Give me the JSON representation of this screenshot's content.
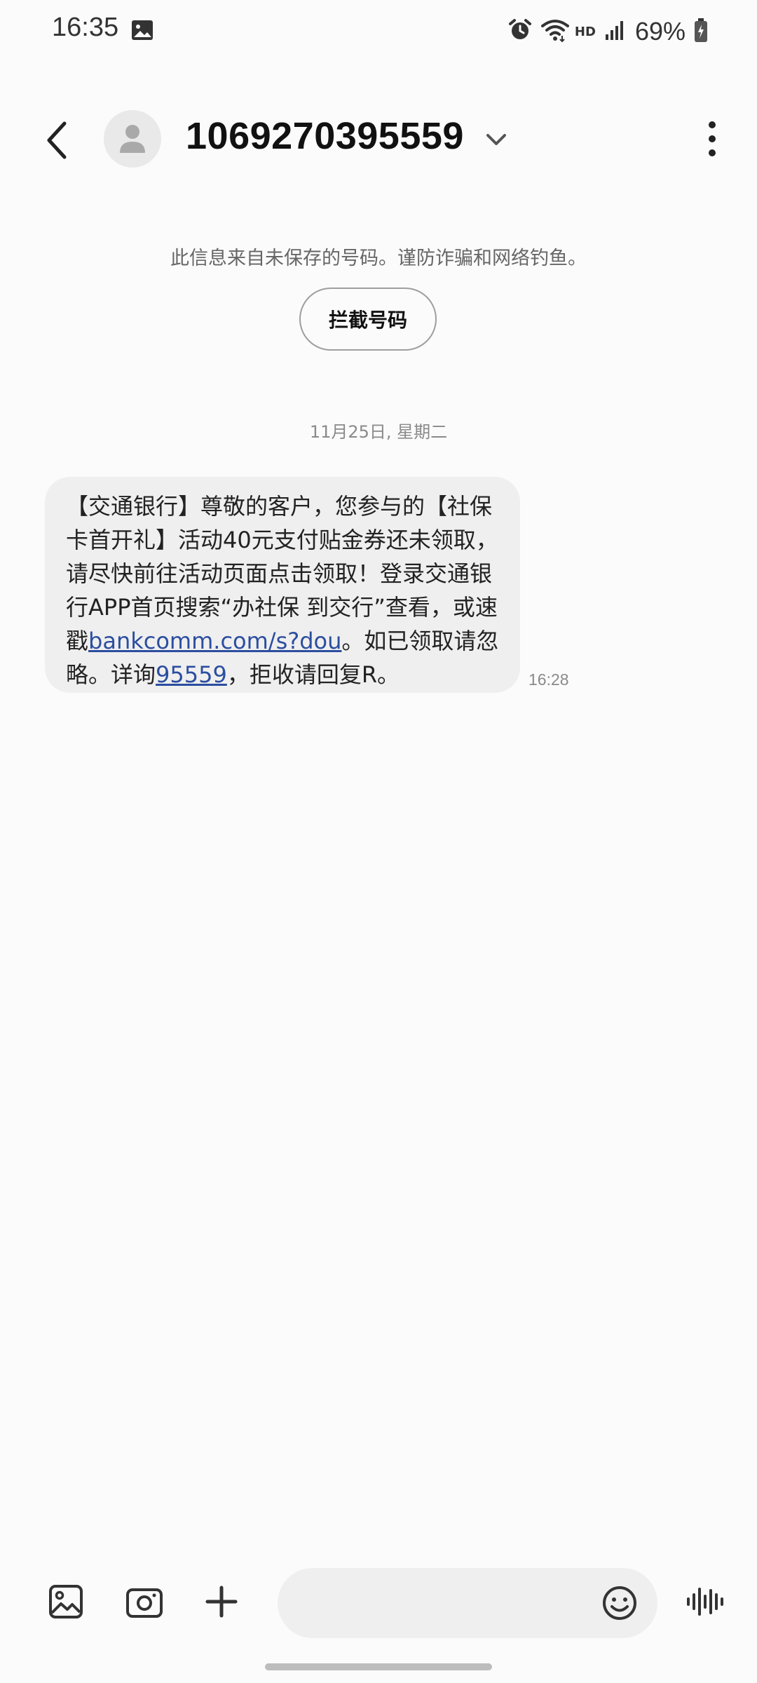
{
  "status_bar": {
    "time": "16:35",
    "network": "HD",
    "battery": "69%",
    "icons": [
      "gallery-icon",
      "alarm-icon",
      "wifi-icon",
      "signal-icon",
      "battery-icon"
    ]
  },
  "header": {
    "contact_number": "1069270395559",
    "icons": [
      "back-icon",
      "avatar-icon",
      "chevron-down-icon",
      "more-vert-icon"
    ]
  },
  "warning": {
    "text": "此信息来自未保存的号码。谨防诈骗和网络钓鱼。",
    "block_button_label": "拦截号码"
  },
  "conversation": {
    "date_separator": "11月25日, 星期二",
    "message": {
      "line1": "【交通银行】尊敬的客户，您参与的【社保",
      "line2": "卡首开礼】活动40元支付贴金券还未领取，",
      "line3": "请尽快前往活动页面点击领取！登录交通银",
      "line4": "行APP首页搜索“办社保 到交行”查看，或速",
      "line5_prefix": "戳",
      "link_url": "bankcomm.com/s?dou",
      "line5_suffix": "。如已领取请忽",
      "line6_prefix": "略。详询",
      "link_phone": "95559",
      "line6_suffix": "，拒收请回复R。",
      "time": "16:28"
    }
  },
  "compose": {
    "placeholder": "",
    "icons": [
      "image-icon",
      "camera-icon",
      "plus-icon",
      "emoji-icon",
      "voice-icon"
    ]
  }
}
